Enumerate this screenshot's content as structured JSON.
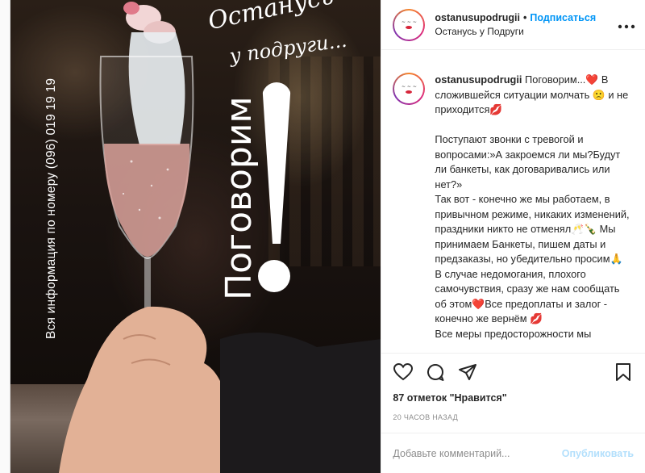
{
  "post_image": {
    "script_title_line1": "Останусь",
    "script_title_line2": "у подруги...",
    "vertical_info": "Вся информация по номеру (096) 019 19 19",
    "vertical_headline": "Поговорим"
  },
  "header": {
    "username": "ostanusupodrugii",
    "separator": "•",
    "follow_label": "Подписаться",
    "subtitle": "Останусь у Подруги",
    "more_icon": "more-horizontal-icon"
  },
  "caption": {
    "username": "ostanusupodrugii",
    "lines": [
      "Поговорим...❤️ В сложившейся ситуации молчать 🙁 и не приходится💋",
      "",
      "Поступают звонки с тревогой и вопросами:»А закроемся ли мы?Будут ли банкеты, как договаривались или нет?»",
      "Так вот - конечно же мы работаем, в привычном режиме, никаких изменений, праздники никто не отменял🥂🍾 Мы принимаем Банкеты, пишем даты и предзаказы, но убедительно просим🙏 В случае недомогания, плохого самочувствия, сразу же нам сообщать об этом❤️Все предоплаты и залог - конечно же вернём 💋",
      "Все меры предосторожности мы"
    ]
  },
  "actions": {
    "like_icon": "heart-icon",
    "comment_icon": "comment-icon",
    "share_icon": "paper-plane-icon",
    "save_icon": "bookmark-icon",
    "likes_text": "87 отметок \"Нравится\"",
    "time_text": "20 ЧАСОВ НАЗАД"
  },
  "comment": {
    "placeholder": "Добавьте комментарий...",
    "publish_label": "Опубликовать"
  },
  "colors": {
    "accent": "#0095f6",
    "publish_disabled": "#b2dffc",
    "text": "#262626",
    "muted": "#8e8e8e"
  }
}
